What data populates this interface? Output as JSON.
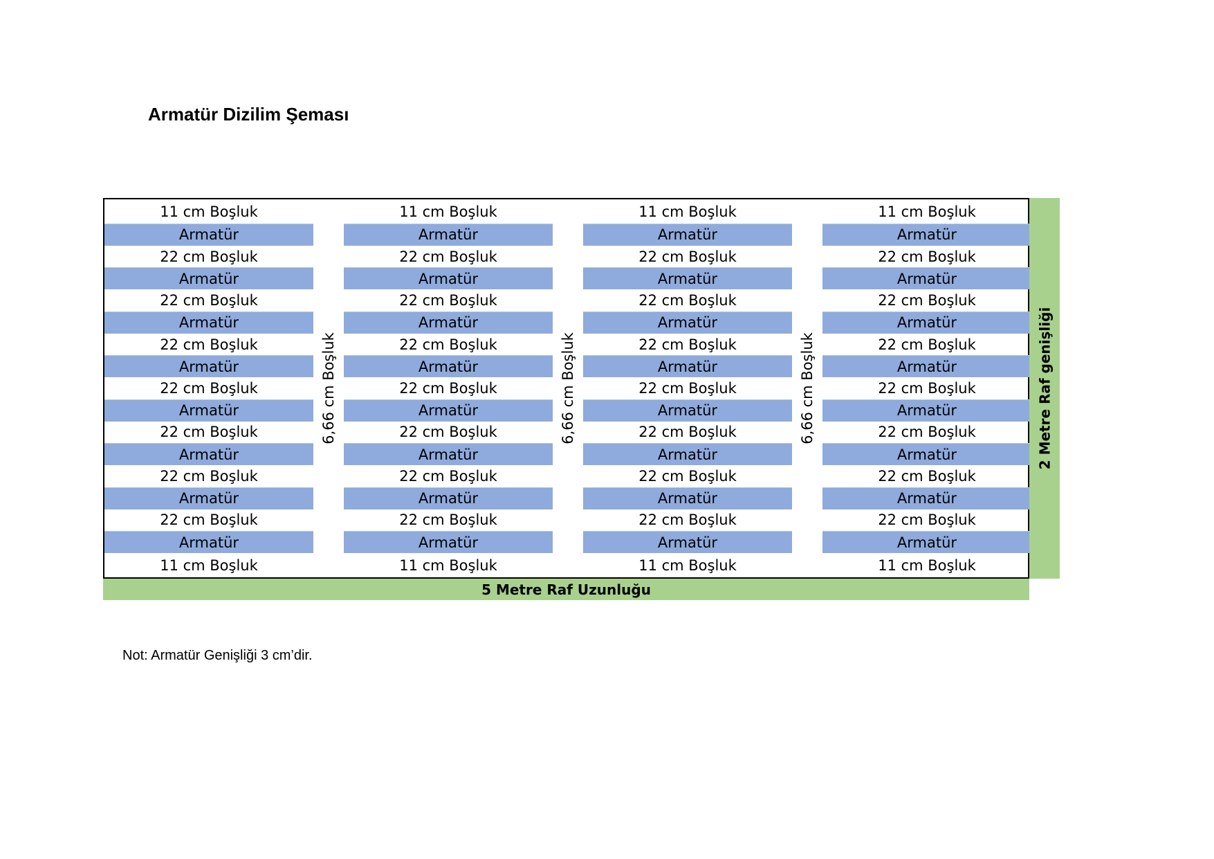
{
  "title": "Armatür Dizilim Şeması",
  "column_count": 4,
  "rows": [
    {
      "type": "gap",
      "label": "11 cm Boşluk"
    },
    {
      "type": "fixture",
      "label": "Armatür"
    },
    {
      "type": "gap",
      "label": "22 cm Boşluk"
    },
    {
      "type": "fixture",
      "label": "Armatür"
    },
    {
      "type": "gap",
      "label": "22 cm Boşluk"
    },
    {
      "type": "fixture",
      "label": "Armatür"
    },
    {
      "type": "gap",
      "label": "22 cm Boşluk"
    },
    {
      "type": "fixture",
      "label": "Armatür"
    },
    {
      "type": "gap",
      "label": "22 cm Boşluk"
    },
    {
      "type": "fixture",
      "label": "Armatür"
    },
    {
      "type": "gap",
      "label": "22 cm Boşluk"
    },
    {
      "type": "fixture",
      "label": "Armatür"
    },
    {
      "type": "gap",
      "label": "22 cm Boşluk"
    },
    {
      "type": "fixture",
      "label": "Armatür"
    },
    {
      "type": "gap",
      "label": "22 cm Boşluk"
    },
    {
      "type": "fixture",
      "label": "Armatür"
    },
    {
      "type": "gap",
      "label": "11 cm Boşluk"
    }
  ],
  "column_gap_label": "6,66 cm Boşluk",
  "width_label": "2 Metre Raf genişliği",
  "length_label": "5 Metre Raf Uzunluğu",
  "note": "Not: Armatür Genişliği 3 cm’dir.",
  "colors": {
    "fixture": "#8faadc",
    "dimension_bar": "#a9d18e",
    "border": "#000000"
  }
}
